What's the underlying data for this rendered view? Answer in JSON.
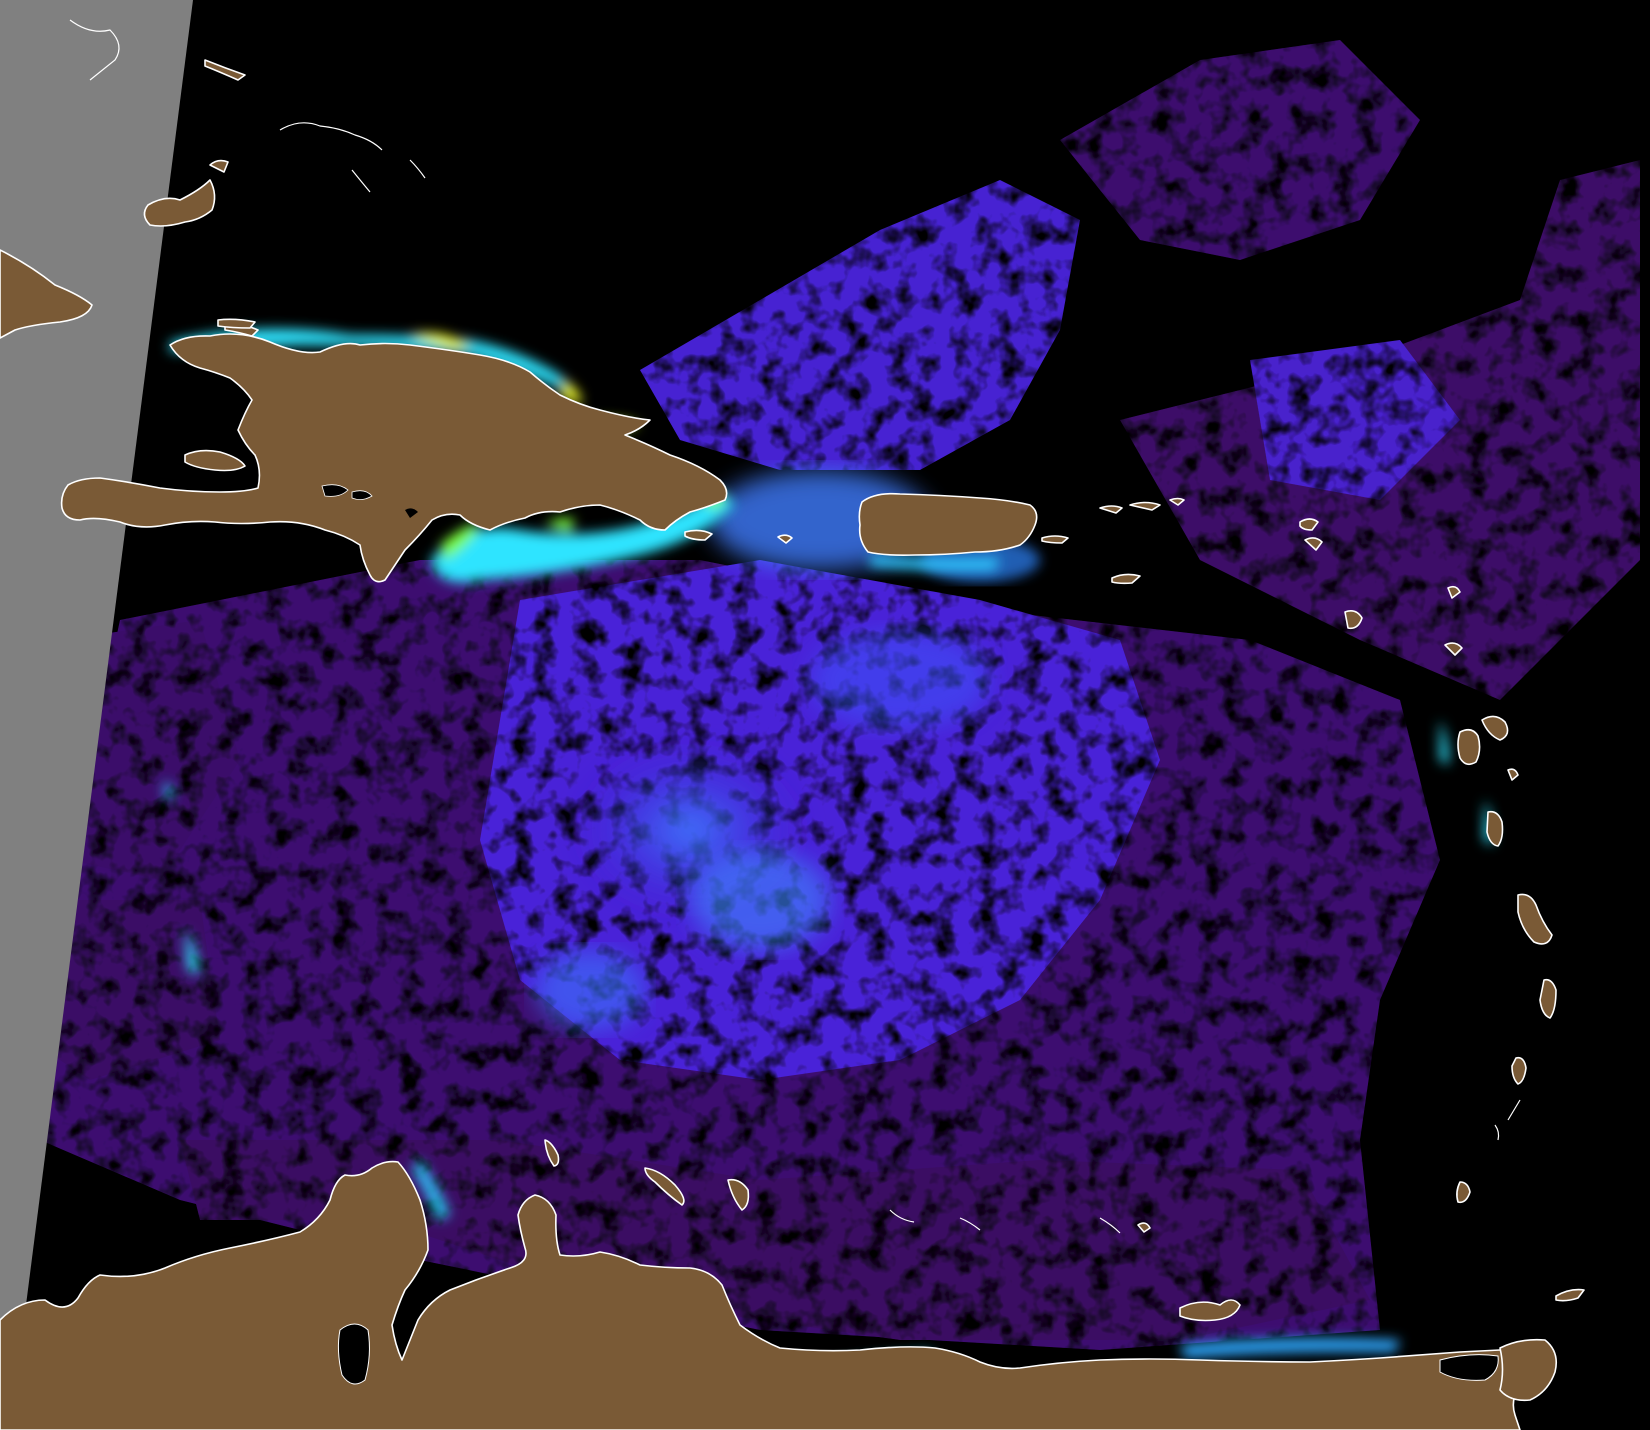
{
  "image_kind": "satellite ocean-color composite",
  "colors": {
    "background_nodata": "#000000",
    "swath_edge_nodata": "#808080",
    "land": "#7a5a36",
    "coastline": "#ffffff",
    "scale_low": "#3a0e58",
    "scale_mid_low": "#4a1fd0",
    "scale_mid": "#2e6bff",
    "scale_mid_high": "#35d6ff",
    "scale_high": "#39ff6a",
    "scale_max": "#f4ff2a"
  }
}
